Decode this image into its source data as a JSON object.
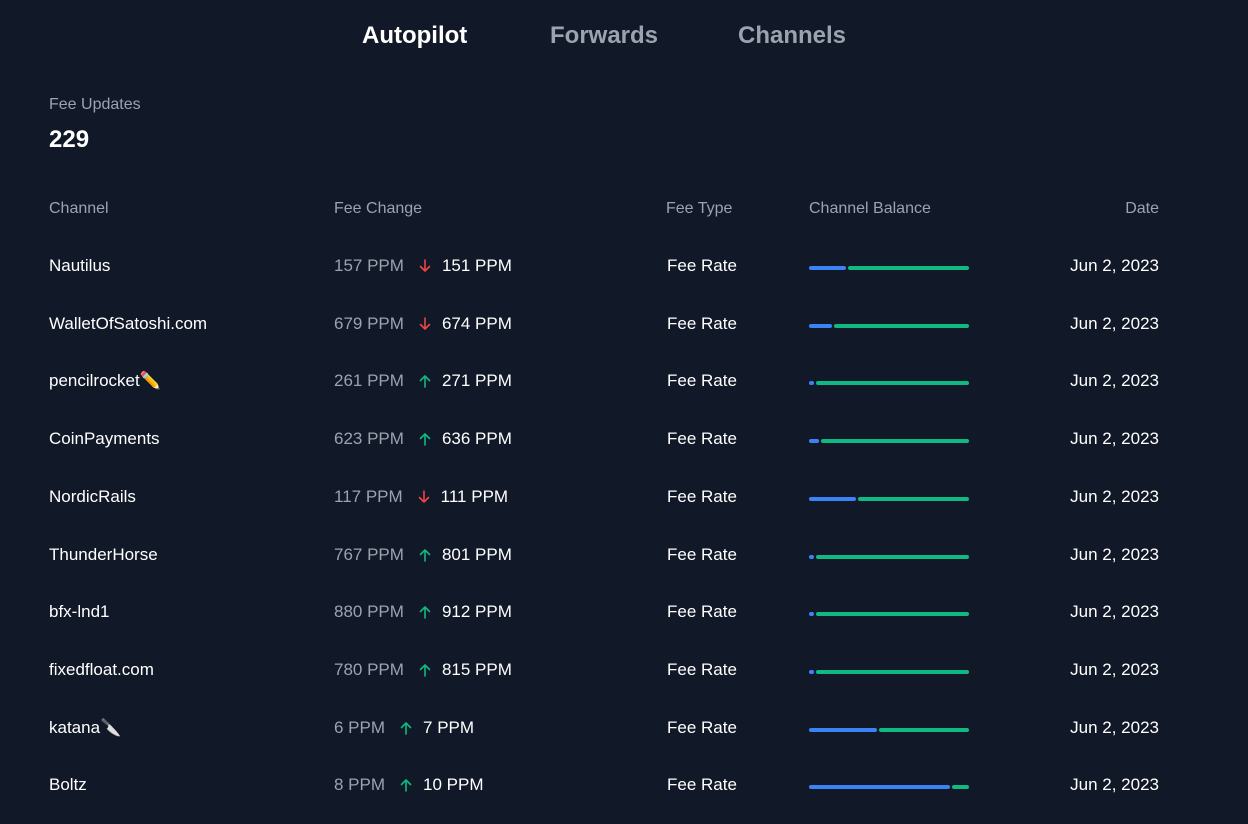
{
  "tabs": [
    {
      "label": "Autopilot",
      "active": true
    },
    {
      "label": "Forwards",
      "active": false
    },
    {
      "label": "Channels",
      "active": false
    }
  ],
  "summary": {
    "label": "Fee Updates",
    "value": "229"
  },
  "table": {
    "headers": {
      "channel": "Channel",
      "fee_change": "Fee Change",
      "fee_type": "Fee Type",
      "channel_balance": "Channel Balance",
      "date": "Date"
    },
    "colors": {
      "local": "#3b82f6",
      "remote": "#10b981",
      "up": "#10b981",
      "down": "#ef4444"
    },
    "rows": [
      {
        "channel": "Nautilus",
        "old_fee": "157 PPM",
        "direction": "down",
        "new_fee": "151 PPM",
        "fee_type": "Fee Rate",
        "local_fraction": 0.24,
        "date": "Jun 2, 2023"
      },
      {
        "channel": "WalletOfSatoshi.com",
        "old_fee": "679 PPM",
        "direction": "down",
        "new_fee": "674 PPM",
        "fee_type": "Fee Rate",
        "local_fraction": 0.15,
        "date": "Jun 2, 2023"
      },
      {
        "channel": "pencilrocket✏️",
        "old_fee": "261 PPM",
        "direction": "up",
        "new_fee": "271 PPM",
        "fee_type": "Fee Rate",
        "local_fraction": 0.04,
        "date": "Jun 2, 2023"
      },
      {
        "channel": "CoinPayments",
        "old_fee": "623 PPM",
        "direction": "up",
        "new_fee": "636 PPM",
        "fee_type": "Fee Rate",
        "local_fraction": 0.07,
        "date": "Jun 2, 2023"
      },
      {
        "channel": "NordicRails",
        "old_fee": "117 PPM",
        "direction": "down",
        "new_fee": "111 PPM",
        "fee_type": "Fee Rate",
        "local_fraction": 0.3,
        "date": "Jun 2, 2023"
      },
      {
        "channel": "ThunderHorse",
        "old_fee": "767 PPM",
        "direction": "up",
        "new_fee": "801 PPM",
        "fee_type": "Fee Rate",
        "local_fraction": 0.04,
        "date": "Jun 2, 2023"
      },
      {
        "channel": "bfx-lnd1",
        "old_fee": "880 PPM",
        "direction": "up",
        "new_fee": "912 PPM",
        "fee_type": "Fee Rate",
        "local_fraction": 0.04,
        "date": "Jun 2, 2023"
      },
      {
        "channel": "fixedfloat.com",
        "old_fee": "780 PPM",
        "direction": "up",
        "new_fee": "815 PPM",
        "fee_type": "Fee Rate",
        "local_fraction": 0.04,
        "date": "Jun 2, 2023"
      },
      {
        "channel": "katana🔪",
        "old_fee": "6 PPM",
        "direction": "up",
        "new_fee": "7 PPM",
        "fee_type": "Fee Rate",
        "local_fraction": 0.43,
        "date": "Jun 2, 2023"
      },
      {
        "channel": "Boltz",
        "old_fee": "8 PPM",
        "direction": "up",
        "new_fee": "10 PPM",
        "fee_type": "Fee Rate",
        "local_fraction": 0.89,
        "date": "Jun 2, 2023"
      }
    ]
  }
}
